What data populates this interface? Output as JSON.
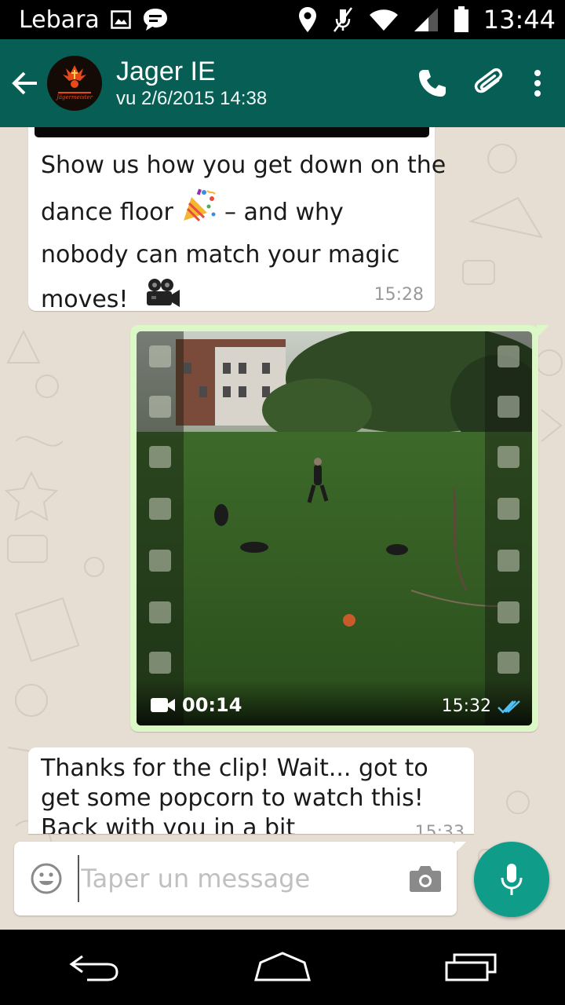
{
  "status_bar": {
    "carrier": "Lebara",
    "time": "13:44"
  },
  "header": {
    "contact_name": "Jager IE",
    "last_seen": "vu 2/6/2015 14:38",
    "avatar_text": "Jägermeister"
  },
  "messages": [
    {
      "direction": "incoming",
      "lines": [
        "Show us how you get down on the",
        "dance floor",
        "– and why",
        "nobody can match your magic",
        "moves!"
      ],
      "emojis": [
        "party-popper",
        "movie-camera"
      ],
      "time": "15:28"
    },
    {
      "direction": "outgoing",
      "type": "video",
      "duration": "00:14",
      "time": "15:32",
      "status": "read"
    },
    {
      "direction": "incoming",
      "text": "Thanks for the clip! Wait... got to get some popcorn to watch this! Back with you in a bit",
      "time": "15:33"
    }
  ],
  "composer": {
    "placeholder": "Taper un message"
  },
  "colors": {
    "app_bar": "#075e54",
    "outgoing_bubble": "#dcf8c6",
    "chat_background": "#e6ddd3",
    "mic_button": "#0f9d89",
    "read_ticks": "#4fc3f7"
  }
}
